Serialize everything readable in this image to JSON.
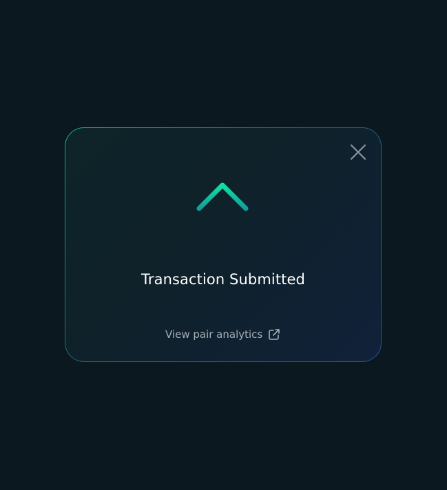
{
  "modal": {
    "title": "Transaction Submitted",
    "link_label": "View pair analytics",
    "close_icon": "close-icon",
    "status_icon": "arrow-up-icon",
    "link_icon": "external-link-icon"
  },
  "colors": {
    "background": "#0c181f",
    "accent_green": "#11b58a",
    "accent_blue": "#2a4ea8",
    "title_text": "#ffffff",
    "link_text": "#a7b0b6"
  }
}
